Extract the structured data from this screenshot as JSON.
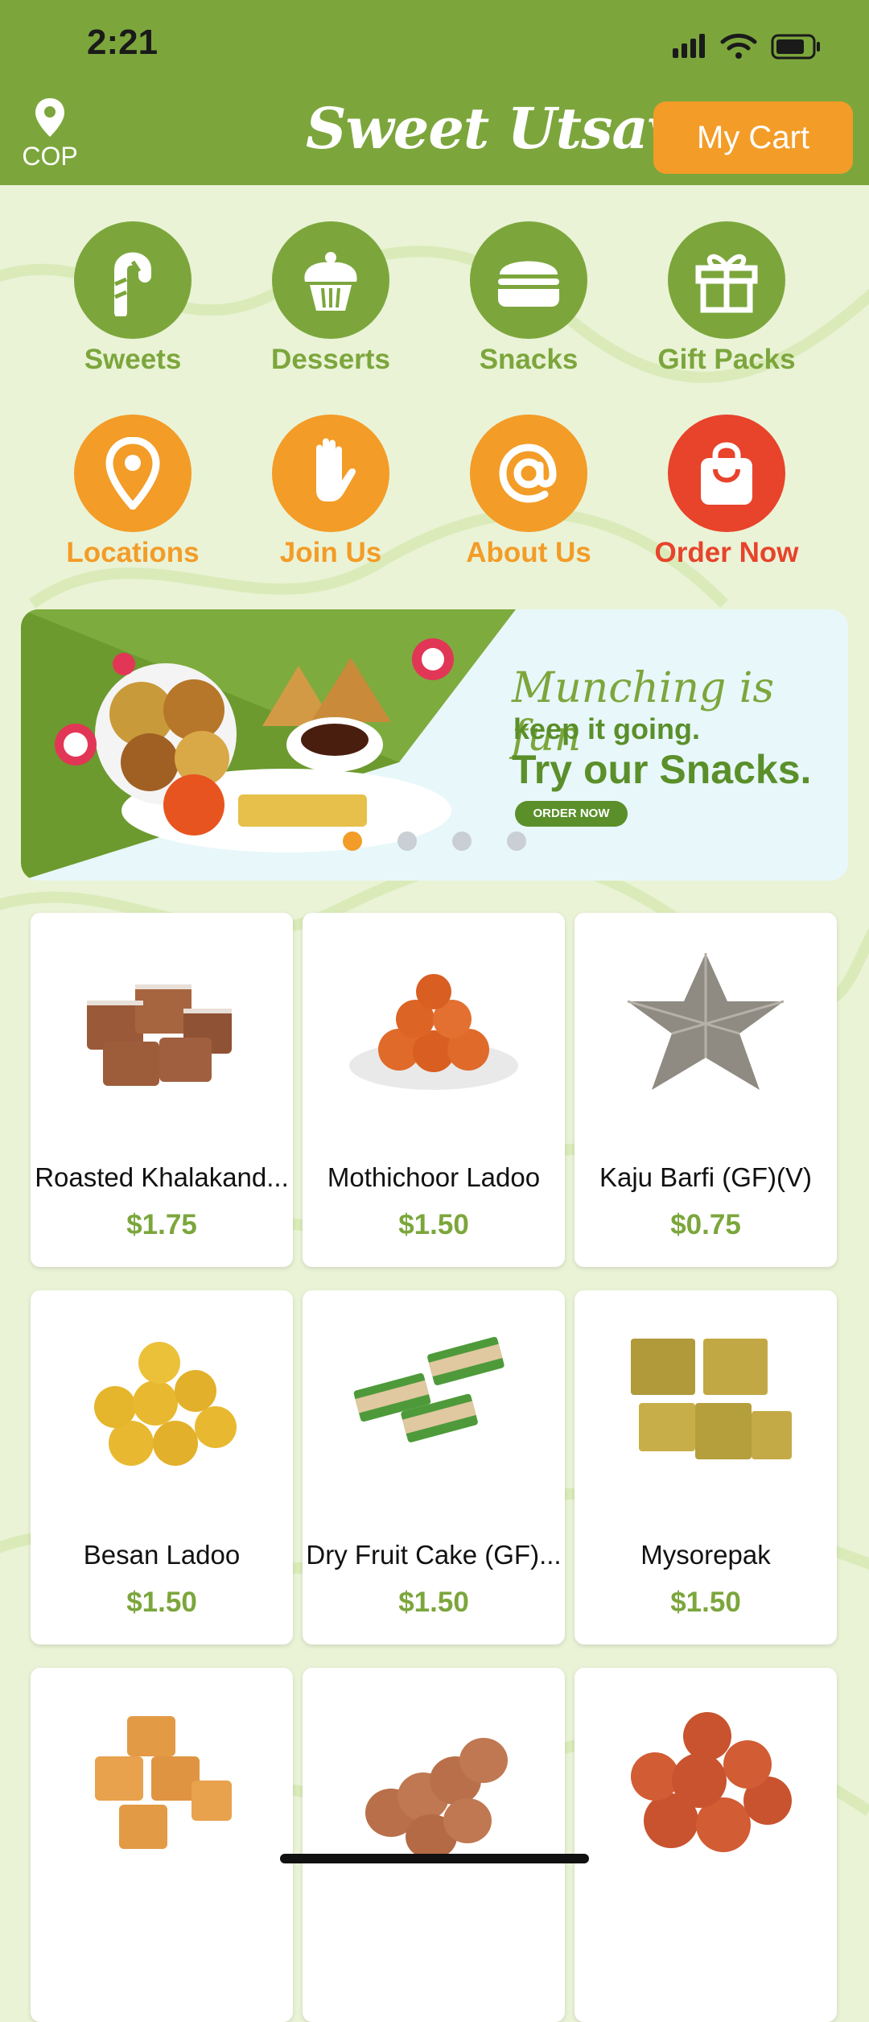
{
  "status_bar": {
    "time": "2:21"
  },
  "header": {
    "location_code": "COP",
    "brand": "Sweet Utsav",
    "cart_label": "My Cart"
  },
  "categories": [
    {
      "label": "Sweets",
      "icon": "candy-cane-icon",
      "color": "#7ca63c"
    },
    {
      "label": "Desserts",
      "icon": "cupcake-icon",
      "color": "#7ca63c"
    },
    {
      "label": "Snacks",
      "icon": "burger-icon",
      "color": "#7ca63c"
    },
    {
      "label": "Gift Packs",
      "icon": "gift-icon",
      "color": "#7ca63c"
    },
    {
      "label": "Locations",
      "icon": "location-pin-icon",
      "color": "#f39c27"
    },
    {
      "label": "Join Us",
      "icon": "hand-icon",
      "color": "#f39c27"
    },
    {
      "label": "About Us",
      "icon": "at-sign-icon",
      "color": "#f39c27"
    },
    {
      "label": "Order Now",
      "icon": "shopping-bag-icon",
      "color": "#e8432b"
    }
  ],
  "banner": {
    "line1": "Munching is fun",
    "line2": "keep it going.",
    "line3": "Try our Snacks.",
    "button": "ORDER NOW",
    "page_count": 4,
    "active_page": 1
  },
  "products": [
    {
      "name": "Roasted Khalakand...",
      "price": "$1.75"
    },
    {
      "name": "Mothichoor Ladoo",
      "price": "$1.50"
    },
    {
      "name": "Kaju Barfi (GF)(V)",
      "price": "$0.75"
    },
    {
      "name": "Besan Ladoo",
      "price": "$1.50"
    },
    {
      "name": "Dry Fruit Cake (GF)...",
      "price": "$1.50"
    },
    {
      "name": "Mysorepak",
      "price": "$1.50"
    },
    {
      "name": "",
      "price": ""
    },
    {
      "name": "",
      "price": ""
    },
    {
      "name": "",
      "price": ""
    }
  ],
  "colors": {
    "brand_green": "#7ca63c",
    "accent_orange": "#f39c27",
    "accent_red": "#e8432b"
  }
}
